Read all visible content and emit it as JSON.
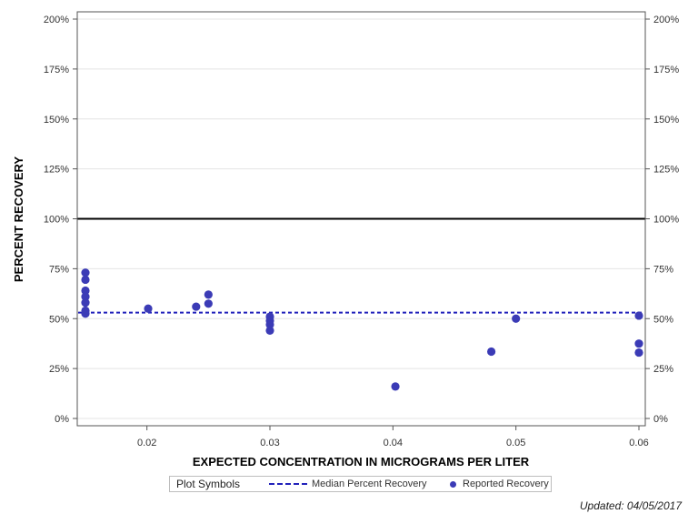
{
  "chart_data": {
    "type": "scatter",
    "title": "",
    "xlabel": "EXPECTED CONCENTRATION IN MICROGRAMS PER LITER",
    "ylabel": "PERCENT RECOVERY",
    "xlim": [
      0.015,
      0.06
    ],
    "ylim": [
      0,
      200
    ],
    "x_ticks": [
      0.02,
      0.03,
      0.04,
      0.05,
      0.06
    ],
    "x_tick_labels": [
      "0.02",
      "0.03",
      "0.04",
      "0.05",
      "0.06"
    ],
    "y_ticks": [
      0,
      25,
      50,
      75,
      100,
      125,
      150,
      175,
      200
    ],
    "y_tick_labels": [
      "0%",
      "25%",
      "50%",
      "75%",
      "100%",
      "125%",
      "150%",
      "175%",
      "200%"
    ],
    "grid": true,
    "reference_line": {
      "y": 100,
      "color": "#000000"
    },
    "median_line": {
      "name": "Median Percent Recovery",
      "y": 53,
      "color": "#2222bb"
    },
    "series": [
      {
        "name": "Reported Recovery",
        "color": "#3b3bb6",
        "points": [
          {
            "x": 0.015,
            "y": 73
          },
          {
            "x": 0.015,
            "y": 69.5
          },
          {
            "x": 0.015,
            "y": 64
          },
          {
            "x": 0.015,
            "y": 61
          },
          {
            "x": 0.015,
            "y": 58
          },
          {
            "x": 0.015,
            "y": 54
          },
          {
            "x": 0.015,
            "y": 52.5
          },
          {
            "x": 0.0201,
            "y": 55
          },
          {
            "x": 0.024,
            "y": 56
          },
          {
            "x": 0.025,
            "y": 62
          },
          {
            "x": 0.025,
            "y": 57.5
          },
          {
            "x": 0.03,
            "y": 51
          },
          {
            "x": 0.03,
            "y": 49
          },
          {
            "x": 0.03,
            "y": 47
          },
          {
            "x": 0.03,
            "y": 44
          },
          {
            "x": 0.0402,
            "y": 16
          },
          {
            "x": 0.048,
            "y": 33.5
          },
          {
            "x": 0.05,
            "y": 50
          },
          {
            "x": 0.06,
            "y": 51.5
          },
          {
            "x": 0.06,
            "y": 37.5
          },
          {
            "x": 0.06,
            "y": 33
          }
        ]
      }
    ]
  },
  "legend": {
    "title": "Plot Symbols",
    "median_label": "Median Percent Recovery",
    "reported_label": "Reported Recovery",
    "placement": "bottom-center"
  },
  "footer": {
    "updated": "Updated: 04/05/2017"
  }
}
